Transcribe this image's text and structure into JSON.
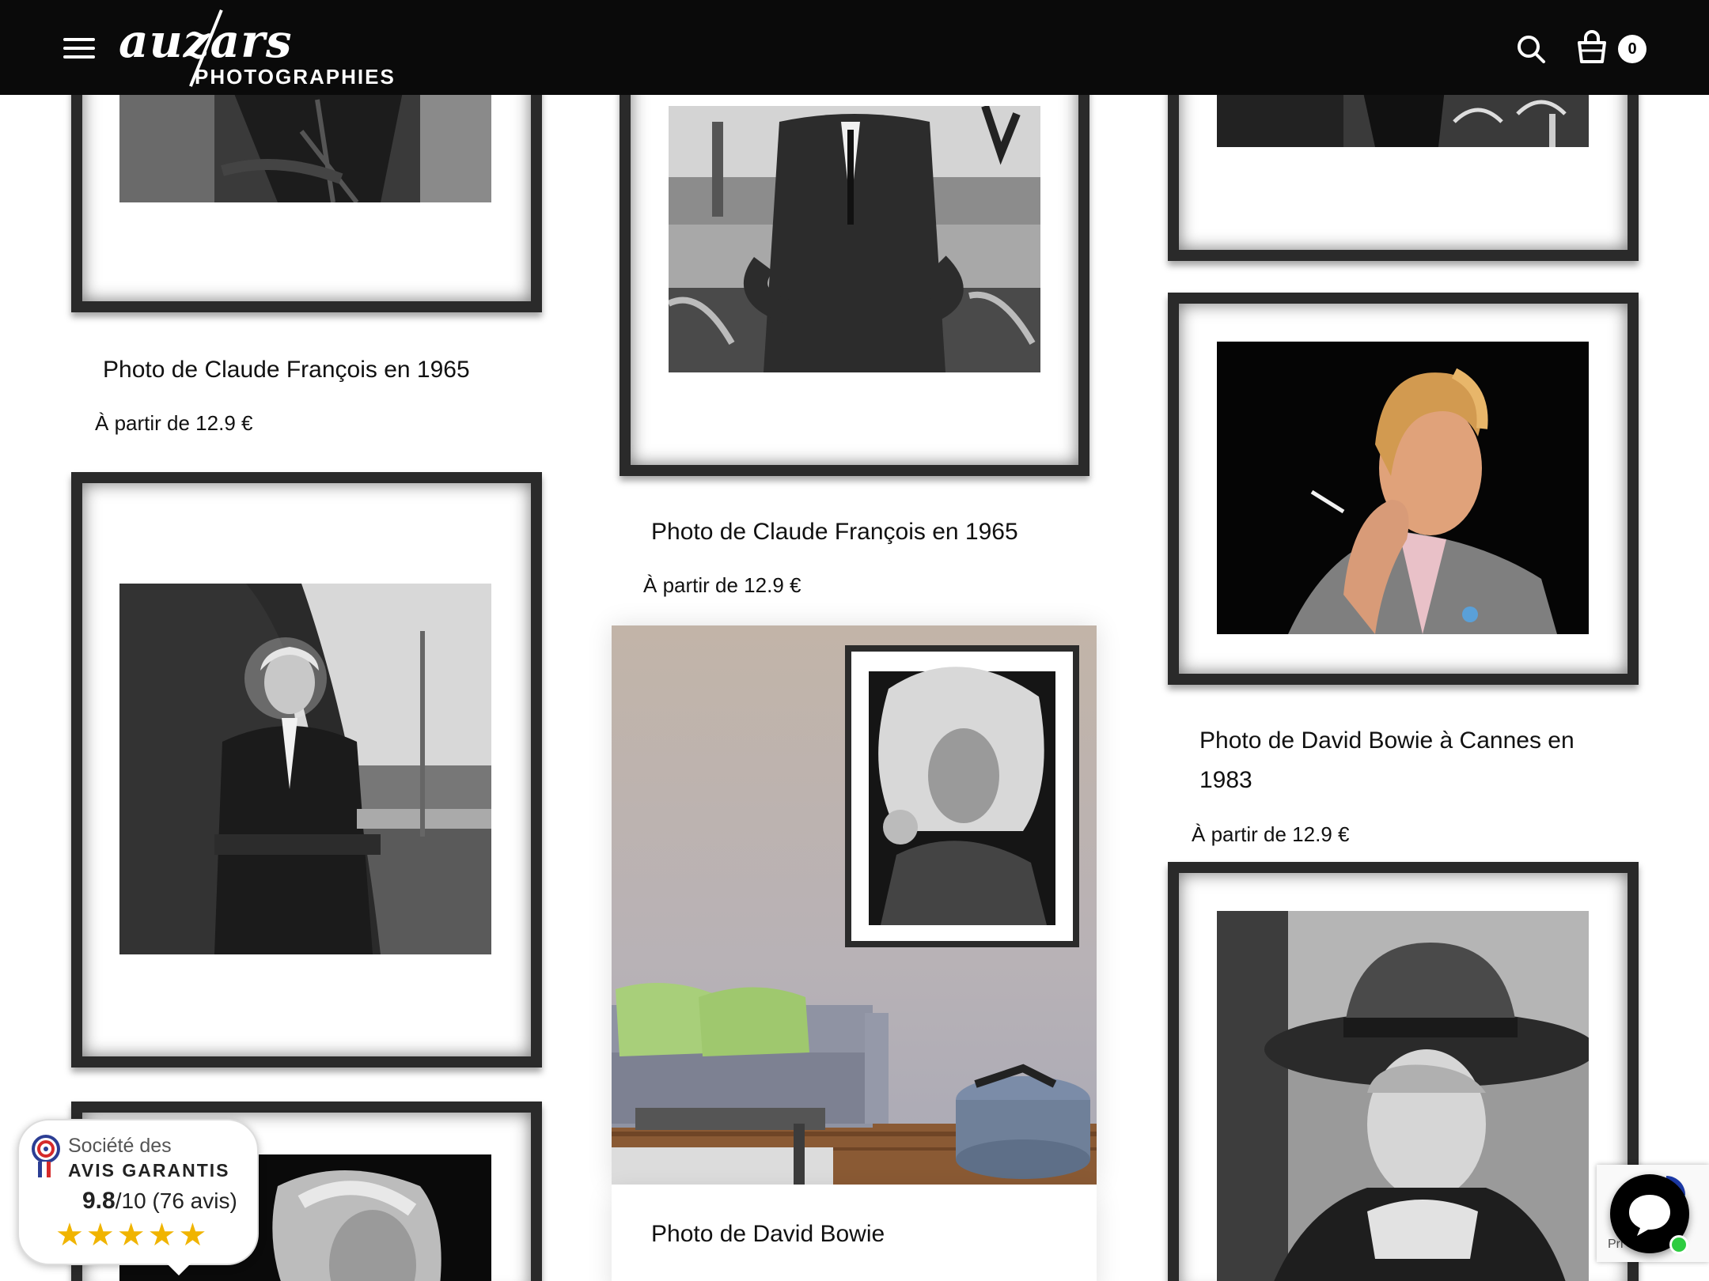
{
  "header": {
    "logo_script": "auzars",
    "logo_sub": "PHOTOGRAPHIES",
    "cart_count": "0",
    "icons": {
      "menu": "hamburger-icon",
      "search": "search-icon",
      "cart": "basket-icon"
    }
  },
  "products": [
    {
      "title": "Photo de Claude François en 1965",
      "price": "À partir de 12.9 €"
    },
    {
      "title": "Photo de Claude François en 1965",
      "price": "À partir de 12.9 €"
    },
    {
      "title_line1": "Photo de David Bowie à Cannes en",
      "title_line2": "1983",
      "price": "À partir de 12.9 €"
    },
    {
      "title": "Photo de David Bowie"
    }
  ],
  "reviews": {
    "line1": "Société des",
    "line2": "AVIS GARANTIS",
    "score": "9.8",
    "scale": "/10 (76 avis)",
    "stars": "★★★★★"
  },
  "recaptcha_text": "Pri",
  "colors": {
    "header_bg": "#0a0a0a",
    "frame": "#2a2a2a",
    "star": "#f0b400",
    "chat_online": "#2ecc40"
  }
}
